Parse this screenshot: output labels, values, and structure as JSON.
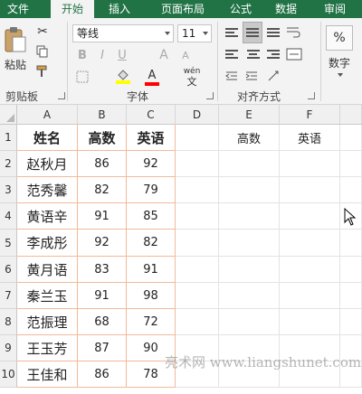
{
  "tabs": [
    {
      "label": "文件",
      "active": false
    },
    {
      "label": "开始",
      "active": true
    },
    {
      "label": "插入",
      "active": false
    },
    {
      "label": "页面布局",
      "active": false
    },
    {
      "label": "公式",
      "active": false
    },
    {
      "label": "数据",
      "active": false
    },
    {
      "label": "审阅",
      "active": false
    }
  ],
  "ribbon": {
    "paste_label": "粘贴",
    "font_name": "等线",
    "font_size": "11",
    "number_label": "数字",
    "percent_symbol": "%",
    "bold": "B",
    "italic": "I",
    "underline": "U",
    "font_color_letter": "A",
    "wen": "wén",
    "wen_char": "文",
    "groups": {
      "clipboard": "剪贴板",
      "font": "字体",
      "alignment": "对齐方式"
    },
    "colors": {
      "highlight": "#ffff00",
      "font_color": "#ff0000",
      "accent": "#217346"
    }
  },
  "grid": {
    "columns": [
      "A",
      "B",
      "C",
      "D",
      "E",
      "F"
    ],
    "rows": [
      "1",
      "2",
      "3",
      "4",
      "5",
      "6",
      "7",
      "8",
      "9",
      "10"
    ],
    "header": [
      "姓名",
      "高数",
      "英语"
    ],
    "records": [
      [
        "赵秋月",
        "86",
        "92"
      ],
      [
        "范秀馨",
        "82",
        "79"
      ],
      [
        "黄语辛",
        "91",
        "85"
      ],
      [
        "李成彤",
        "92",
        "82"
      ],
      [
        "黄月语",
        "83",
        "91"
      ],
      [
        "秦兰玉",
        "91",
        "98"
      ],
      [
        "范振理",
        "68",
        "72"
      ],
      [
        "王玉芳",
        "87",
        "90"
      ],
      [
        "王佳和",
        "86",
        "78"
      ]
    ],
    "e1": "高数",
    "f1": "英语"
  },
  "watermark": "亮术网 www.liangshunet.com"
}
